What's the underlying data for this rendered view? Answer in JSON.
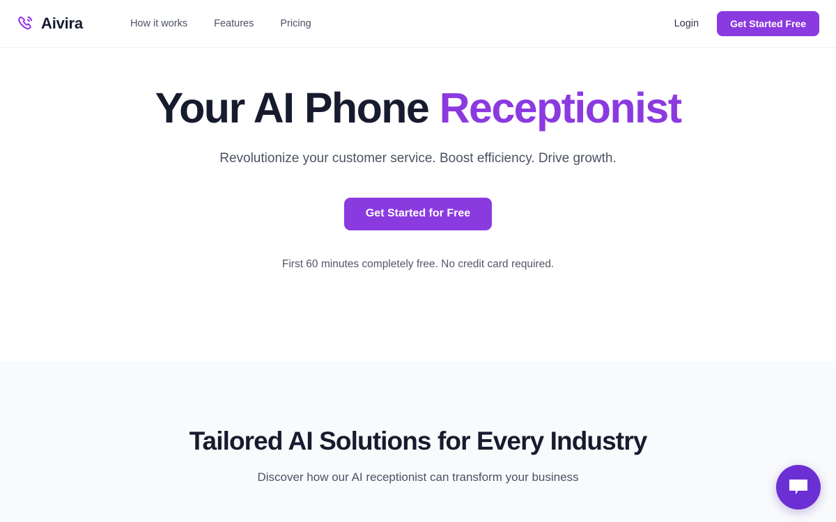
{
  "header": {
    "brand": {
      "name": "Aivira",
      "icon": "phone-call-icon"
    },
    "nav_items": [
      {
        "label": "How it works"
      },
      {
        "label": "Features"
      },
      {
        "label": "Pricing"
      }
    ],
    "login_label": "Login",
    "cta_label": "Get Started Free"
  },
  "hero": {
    "title_lead": "Your AI Phone ",
    "title_accent": "Receptionist",
    "subtitle": "Revolutionize your customer service. Boost efficiency. Drive growth.",
    "cta_label": "Get Started for Free",
    "note": "First 60 minutes completely free. No credit card required."
  },
  "industries": {
    "title": "Tailored AI Solutions for Every Industry",
    "subtitle": "Discover how our AI receptionist can transform your business"
  },
  "chat_widget": {
    "icon": "chat-bubble-icon"
  },
  "colors": {
    "accent_purple": "#8b3ae0",
    "chat_purple": "#6b2fd4",
    "text_dark": "#161b2e",
    "text_muted": "#4b5262",
    "section_bg": "#f8fafc",
    "header_border": "#eef0f3"
  }
}
